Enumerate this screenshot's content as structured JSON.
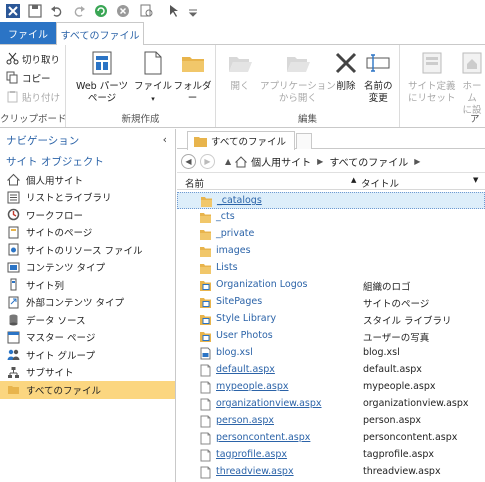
{
  "ribbon_tabs": {
    "file": "ファイル",
    "all_files": "すべてのファイル"
  },
  "clipboard": {
    "cut": "切り取り",
    "copy": "コピー",
    "paste": "貼り付け",
    "label": "クリップボード"
  },
  "new_group": {
    "web_parts_page_line1": "Web パーツ",
    "web_parts_page_line2": "ページ",
    "file_line1": "ファイル",
    "folder": "フォルダー",
    "label": "新規作成"
  },
  "edit_group": {
    "open": "開く",
    "open_from_app_line1": "アプリケーション",
    "open_from_app_line2": "から開く",
    "delete": "削除",
    "rename_line1": "名前の",
    "rename_line2": "変更",
    "label": "編集"
  },
  "extra_group": {
    "reset_site_def_line1": "サイト定義",
    "reset_site_def_line2": "にリセット",
    "home_line1": "ホーム",
    "home_line2": "に設",
    "label": "ア"
  },
  "nav": {
    "header": "ナビゲーション",
    "site_objects": "サイト オブジェクト",
    "items": [
      {
        "label": "個人用サイト",
        "icon": "home-icon"
      },
      {
        "label": "リストとライブラリ",
        "icon": "list-icon"
      },
      {
        "label": "ワークフロー",
        "icon": "workflow-icon"
      },
      {
        "label": "サイトのページ",
        "icon": "page-icon"
      },
      {
        "label": "サイトのリソース ファイル",
        "icon": "resource-icon"
      },
      {
        "label": "コンテンツ タイプ",
        "icon": "content-type-icon"
      },
      {
        "label": "サイト列",
        "icon": "column-icon"
      },
      {
        "label": "外部コンテンツ タイプ",
        "icon": "external-content-icon"
      },
      {
        "label": "データ ソース",
        "icon": "data-source-icon"
      },
      {
        "label": "マスター ページ",
        "icon": "master-page-icon"
      },
      {
        "label": "サイト グループ",
        "icon": "group-icon"
      },
      {
        "label": "サブサイト",
        "icon": "subsite-icon"
      },
      {
        "label": "すべてのファイル",
        "icon": "folder-icon"
      }
    ]
  },
  "doc_tab": {
    "title": "すべてのファイル"
  },
  "breadcrumb": {
    "root": "個人用サイト",
    "current": "すべてのファイル"
  },
  "columns": {
    "name": "名前",
    "title": "タイトル"
  },
  "rows": [
    {
      "name": "_catalogs",
      "title": "",
      "type": "folder"
    },
    {
      "name": "_cts",
      "title": "",
      "type": "folder"
    },
    {
      "name": "_private",
      "title": "",
      "type": "folder"
    },
    {
      "name": "images",
      "title": "",
      "type": "folder"
    },
    {
      "name": "Lists",
      "title": "",
      "type": "folder"
    },
    {
      "name": "Organization Logos",
      "title": "組織のロゴ",
      "type": "library"
    },
    {
      "name": "SitePages",
      "title": "サイトのページ",
      "type": "library"
    },
    {
      "name": "Style Library",
      "title": "スタイル ライブラリ",
      "type": "library"
    },
    {
      "name": "User Photos",
      "title": "ユーザーの写真",
      "type": "library"
    },
    {
      "name": "blog.xsl",
      "title": "blog.xsl",
      "type": "xsl"
    },
    {
      "name": "default.aspx",
      "title": "default.aspx",
      "type": "file"
    },
    {
      "name": "mypeople.aspx",
      "title": "mypeople.aspx",
      "type": "file"
    },
    {
      "name": "organizationview.aspx",
      "title": "organizationview.aspx",
      "type": "file"
    },
    {
      "name": "person.aspx",
      "title": "person.aspx",
      "type": "file"
    },
    {
      "name": "personcontent.aspx",
      "title": "personcontent.aspx",
      "type": "file"
    },
    {
      "name": "tagprofile.aspx",
      "title": "tagprofile.aspx",
      "type": "file"
    },
    {
      "name": "threadview.aspx",
      "title": "threadview.aspx",
      "type": "file"
    }
  ],
  "colors": {
    "accent": "#2b74c5",
    "link": "#2b63a8",
    "selected_nav": "#fbd680",
    "folder": "#e8b44c"
  }
}
